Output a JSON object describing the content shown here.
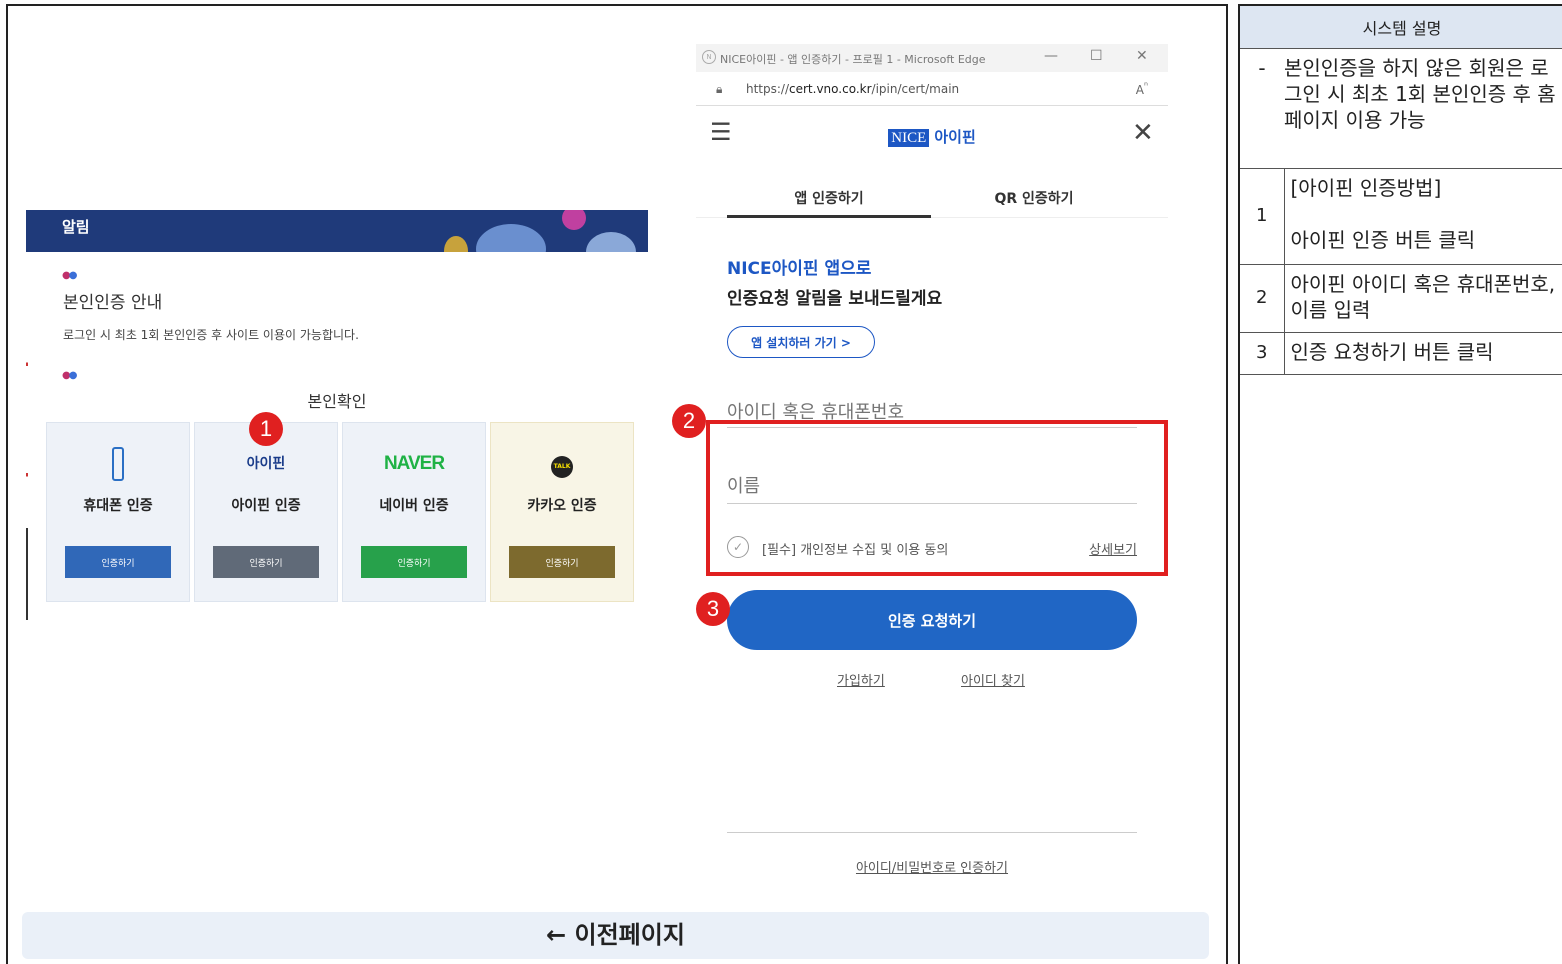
{
  "notice": {
    "header_title": "알림",
    "heading": "본인인증 안내",
    "text": "로그인 시 최초 1회 본인인증 후 사이트 이용이 가능합니다.",
    "subheading": "본인확인",
    "cards": [
      {
        "label": "휴대폰 인증",
        "button": "인증하기",
        "color": "#3068b8"
      },
      {
        "label": "아이핀 인증",
        "button": "인증하기",
        "color": "#606a78",
        "logo": "아이핀"
      },
      {
        "label": "네이버 인증",
        "button": "인증하기",
        "color": "#27a14b",
        "logo": "NAVER"
      },
      {
        "label": "카카오 인증",
        "button": "인증하기",
        "color": "#7d6a2e",
        "logo": "TALK"
      }
    ]
  },
  "badges": {
    "one": "1",
    "two": "2",
    "three": "3"
  },
  "popup": {
    "window_title": "NICE아이핀 - 앱 인증하기 - 프로필 1 - Microsoft Edge",
    "url_prefix": "https://",
    "url_domain": "cert.vno.co.kr",
    "url_path": "/ipin/cert/main",
    "brand_nice": "NICE",
    "brand_ipin": "아이핀",
    "tab_app": "앱 인증하기",
    "tab_qr": "QR 인증하기",
    "title_line1": "NICE아이핀 앱으로",
    "title_line2": "인증요청 알림을 보내드릴게요",
    "install_button": "앱 설치하러 가기 >",
    "id_placeholder": "아이디 혹은 휴대폰번호",
    "name_placeholder": "이름",
    "consent_text": "[필수] 개인정보 수집 및 이용 동의",
    "consent_detail": "상세보기",
    "request_button": "인증 요청하기",
    "join_link": "가입하기",
    "find_id_link": "아이디 찾기",
    "id_pw_link": "아이디/비밀번호로 인증하기"
  },
  "back_button": "← 이전페이지",
  "description": {
    "header": "시스템 설명",
    "intro_bullet": "-",
    "intro": "본인인증을 하지 않은 회원은 로그인 시 최초 1회 본인인증 후 홈페이지 이용 가능",
    "steps": [
      {
        "num": "1",
        "title": "[아이핀 인증방법]",
        "text": "아이핀 인증 버튼 클릭"
      },
      {
        "num": "2",
        "text": "아이핀 아이디 혹은 휴대폰번호, 이름 입력"
      },
      {
        "num": "3",
        "text": "인증 요청하기 버튼 클릭"
      }
    ]
  }
}
